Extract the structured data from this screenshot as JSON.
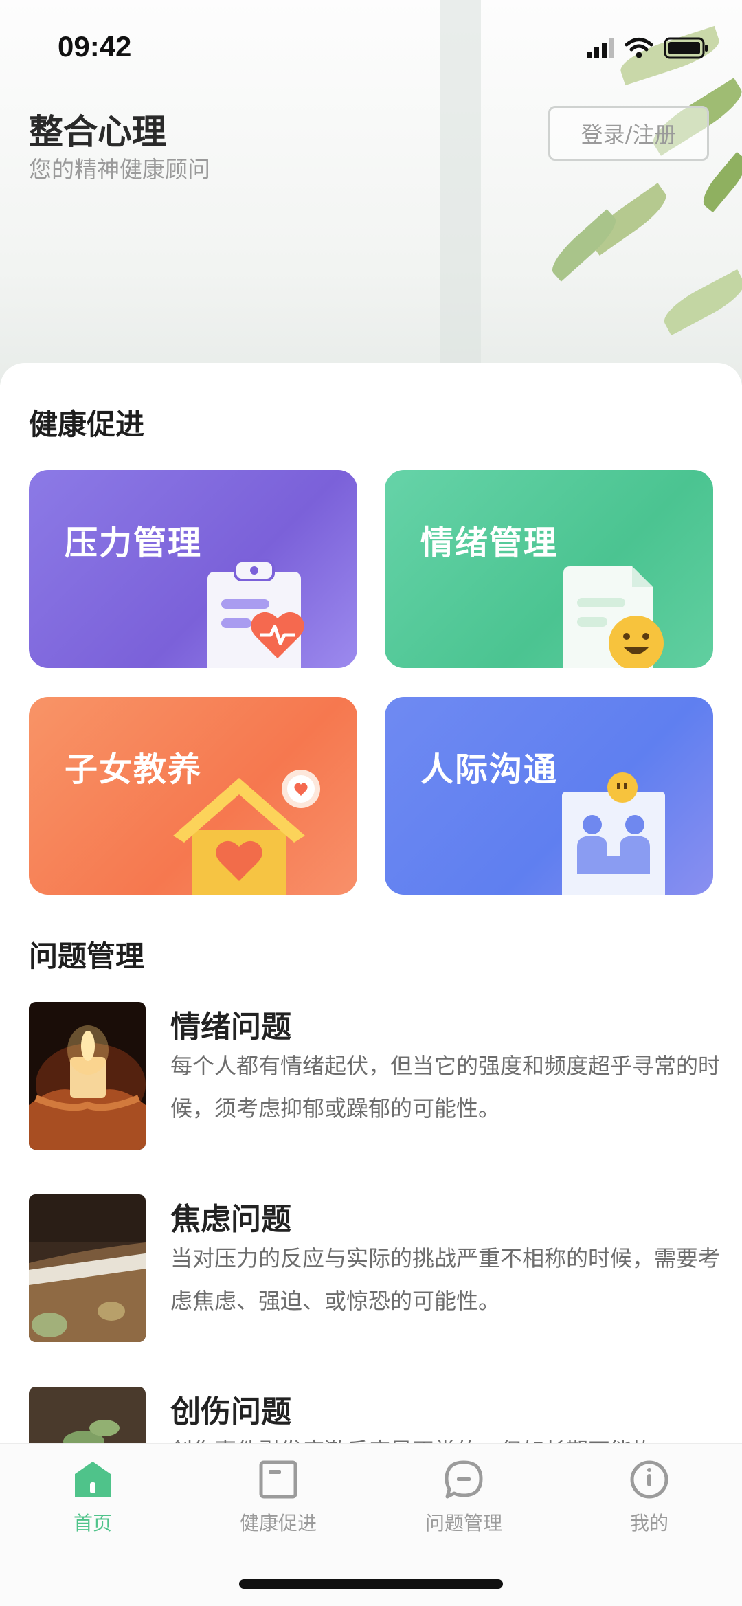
{
  "status_bar": {
    "time": "09:42"
  },
  "header": {
    "title": "整合心理",
    "subtitle": "您的精神健康顾问",
    "login_label": "登录/注册"
  },
  "health_section": {
    "title": "健康促进",
    "cards": [
      {
        "label": "压力管理",
        "icon": "clipboard-heart-icon",
        "color": "#8b72e0"
      },
      {
        "label": "情绪管理",
        "icon": "document-smile-icon",
        "color": "#54c99b"
      },
      {
        "label": "子女教养",
        "icon": "house-heart-icon",
        "color": "#f7875a"
      },
      {
        "label": "人际沟通",
        "icon": "people-chat-icon",
        "color": "#6b8cf3"
      }
    ]
  },
  "problem_section": {
    "title": "问题管理",
    "items": [
      {
        "title": "情绪问题",
        "desc": "每个人都有情绪起伏，但当它的强度和频度超乎寻常的时候，须考虑抑郁或躁郁的可能性。"
      },
      {
        "title": "焦虑问题",
        "desc": "当对压力的反应与实际的挑战严重不相称的时候，需要考虑焦虑、强迫、或惊恐的可能性。"
      },
      {
        "title": "创伤问题",
        "desc": "创伤事件引发应激反应是正常的，但如长期不能恢"
      }
    ]
  },
  "tab_bar": {
    "tabs": [
      {
        "label": "首页",
        "icon": "home-icon",
        "active": true
      },
      {
        "label": "健康促进",
        "icon": "square-tab-icon",
        "active": false
      },
      {
        "label": "问题管理",
        "icon": "chat-bubble-icon",
        "active": false
      },
      {
        "label": "我的",
        "icon": "user-circle-icon",
        "active": false
      }
    ]
  },
  "colors": {
    "accent": "#4fc38a",
    "inactive": "#9b9b9b"
  }
}
